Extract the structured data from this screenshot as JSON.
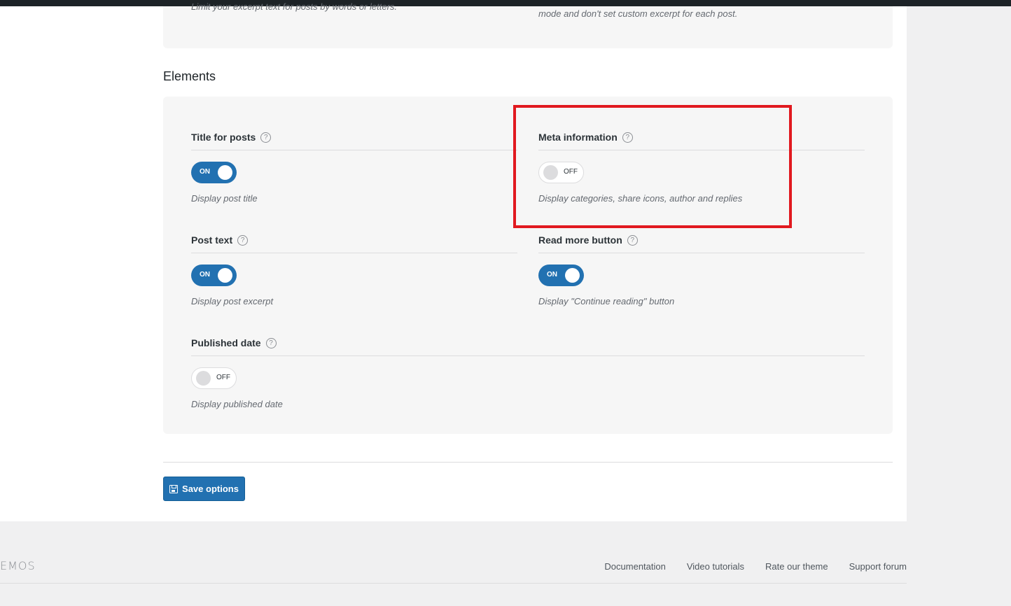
{
  "truncated_section": {
    "left_text": "Limit your excerpt text for posts by words or letters.",
    "right_text": "mode and don't set custom excerpt for each post."
  },
  "elements": {
    "title": "Elements",
    "options": [
      {
        "label": "Title for posts",
        "state": "ON",
        "description": "Display post title"
      },
      {
        "label": "Meta information",
        "state": "OFF",
        "description": "Display categories, share icons, author and replies"
      },
      {
        "label": "Post text",
        "state": "ON",
        "description": "Display post excerpt"
      },
      {
        "label": "Read more button",
        "state": "ON",
        "description": "Display \"Continue reading\" button"
      },
      {
        "label": "Published date",
        "state": "OFF",
        "description": "Display published date"
      }
    ],
    "help_glyph": "?"
  },
  "save_button": {
    "label": "Save options",
    "icon": "save-icon"
  },
  "footer": {
    "brand": "EMOS",
    "links": [
      "Documentation",
      "Video tutorials",
      "Rate our theme",
      "Support forum"
    ]
  },
  "colors": {
    "accent": "#2271b1",
    "highlight": "#e1191f",
    "panel": "#f6f6f6"
  }
}
